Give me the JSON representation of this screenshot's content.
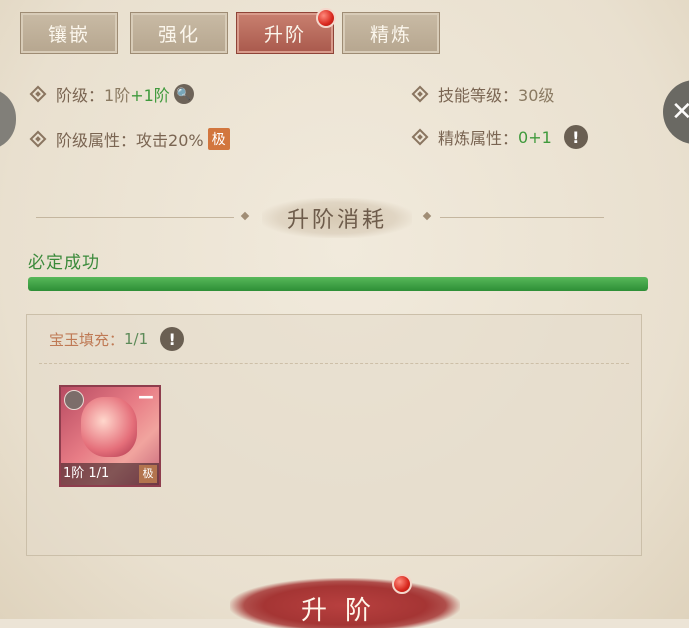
{
  "tabs": [
    {
      "label": "镶嵌",
      "active": false
    },
    {
      "label": "强化",
      "active": false
    },
    {
      "label": "升阶",
      "active": true
    },
    {
      "label": "精炼",
      "active": false
    }
  ],
  "attrs": {
    "stage_label": "阶级：",
    "stage_value": "1阶",
    "stage_bonus": "+1阶",
    "stage_attr_label": "阶级属性：",
    "stage_attr_value": "攻击20%",
    "stage_attr_badge": "极",
    "skill_label": "技能等级：",
    "skill_value": "30级",
    "refine_label": "精炼属性：",
    "refine_base": "0",
    "refine_bonus": "+1"
  },
  "cost": {
    "title": "升阶消耗",
    "success_text": "必定成功",
    "success_progress": 1.0
  },
  "jade": {
    "label": "宝玉填充：",
    "count": "1/1",
    "item_label": "1阶 1/1",
    "item_badge": "极"
  },
  "action": {
    "upgrade_label": "升阶"
  },
  "colors": {
    "active_tab": "#a9594c",
    "progress_green": "#3f9a3c",
    "red_dot": "#d8281e"
  }
}
